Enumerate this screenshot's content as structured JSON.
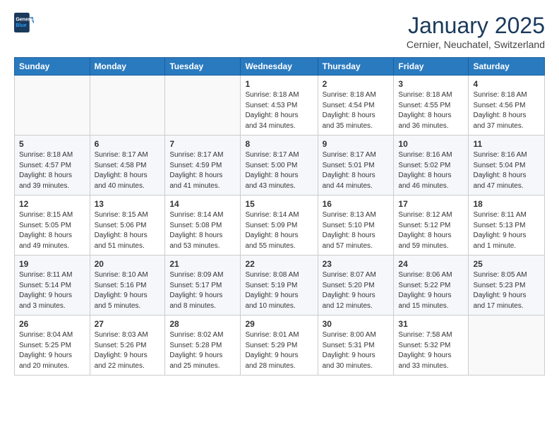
{
  "header": {
    "logo_general": "General",
    "logo_blue": "Blue",
    "month_title": "January 2025",
    "subtitle": "Cernier, Neuchatel, Switzerland"
  },
  "weekdays": [
    "Sunday",
    "Monday",
    "Tuesday",
    "Wednesday",
    "Thursday",
    "Friday",
    "Saturday"
  ],
  "weeks": [
    [
      {
        "day": "",
        "info": ""
      },
      {
        "day": "",
        "info": ""
      },
      {
        "day": "",
        "info": ""
      },
      {
        "day": "1",
        "info": "Sunrise: 8:18 AM\nSunset: 4:53 PM\nDaylight: 8 hours\nand 34 minutes."
      },
      {
        "day": "2",
        "info": "Sunrise: 8:18 AM\nSunset: 4:54 PM\nDaylight: 8 hours\nand 35 minutes."
      },
      {
        "day": "3",
        "info": "Sunrise: 8:18 AM\nSunset: 4:55 PM\nDaylight: 8 hours\nand 36 minutes."
      },
      {
        "day": "4",
        "info": "Sunrise: 8:18 AM\nSunset: 4:56 PM\nDaylight: 8 hours\nand 37 minutes."
      }
    ],
    [
      {
        "day": "5",
        "info": "Sunrise: 8:18 AM\nSunset: 4:57 PM\nDaylight: 8 hours\nand 39 minutes."
      },
      {
        "day": "6",
        "info": "Sunrise: 8:17 AM\nSunset: 4:58 PM\nDaylight: 8 hours\nand 40 minutes."
      },
      {
        "day": "7",
        "info": "Sunrise: 8:17 AM\nSunset: 4:59 PM\nDaylight: 8 hours\nand 41 minutes."
      },
      {
        "day": "8",
        "info": "Sunrise: 8:17 AM\nSunset: 5:00 PM\nDaylight: 8 hours\nand 43 minutes."
      },
      {
        "day": "9",
        "info": "Sunrise: 8:17 AM\nSunset: 5:01 PM\nDaylight: 8 hours\nand 44 minutes."
      },
      {
        "day": "10",
        "info": "Sunrise: 8:16 AM\nSunset: 5:02 PM\nDaylight: 8 hours\nand 46 minutes."
      },
      {
        "day": "11",
        "info": "Sunrise: 8:16 AM\nSunset: 5:04 PM\nDaylight: 8 hours\nand 47 minutes."
      }
    ],
    [
      {
        "day": "12",
        "info": "Sunrise: 8:15 AM\nSunset: 5:05 PM\nDaylight: 8 hours\nand 49 minutes."
      },
      {
        "day": "13",
        "info": "Sunrise: 8:15 AM\nSunset: 5:06 PM\nDaylight: 8 hours\nand 51 minutes."
      },
      {
        "day": "14",
        "info": "Sunrise: 8:14 AM\nSunset: 5:08 PM\nDaylight: 8 hours\nand 53 minutes."
      },
      {
        "day": "15",
        "info": "Sunrise: 8:14 AM\nSunset: 5:09 PM\nDaylight: 8 hours\nand 55 minutes."
      },
      {
        "day": "16",
        "info": "Sunrise: 8:13 AM\nSunset: 5:10 PM\nDaylight: 8 hours\nand 57 minutes."
      },
      {
        "day": "17",
        "info": "Sunrise: 8:12 AM\nSunset: 5:12 PM\nDaylight: 8 hours\nand 59 minutes."
      },
      {
        "day": "18",
        "info": "Sunrise: 8:11 AM\nSunset: 5:13 PM\nDaylight: 9 hours\nand 1 minute."
      }
    ],
    [
      {
        "day": "19",
        "info": "Sunrise: 8:11 AM\nSunset: 5:14 PM\nDaylight: 9 hours\nand 3 minutes."
      },
      {
        "day": "20",
        "info": "Sunrise: 8:10 AM\nSunset: 5:16 PM\nDaylight: 9 hours\nand 5 minutes."
      },
      {
        "day": "21",
        "info": "Sunrise: 8:09 AM\nSunset: 5:17 PM\nDaylight: 9 hours\nand 8 minutes."
      },
      {
        "day": "22",
        "info": "Sunrise: 8:08 AM\nSunset: 5:19 PM\nDaylight: 9 hours\nand 10 minutes."
      },
      {
        "day": "23",
        "info": "Sunrise: 8:07 AM\nSunset: 5:20 PM\nDaylight: 9 hours\nand 12 minutes."
      },
      {
        "day": "24",
        "info": "Sunrise: 8:06 AM\nSunset: 5:22 PM\nDaylight: 9 hours\nand 15 minutes."
      },
      {
        "day": "25",
        "info": "Sunrise: 8:05 AM\nSunset: 5:23 PM\nDaylight: 9 hours\nand 17 minutes."
      }
    ],
    [
      {
        "day": "26",
        "info": "Sunrise: 8:04 AM\nSunset: 5:25 PM\nDaylight: 9 hours\nand 20 minutes."
      },
      {
        "day": "27",
        "info": "Sunrise: 8:03 AM\nSunset: 5:26 PM\nDaylight: 9 hours\nand 22 minutes."
      },
      {
        "day": "28",
        "info": "Sunrise: 8:02 AM\nSunset: 5:28 PM\nDaylight: 9 hours\nand 25 minutes."
      },
      {
        "day": "29",
        "info": "Sunrise: 8:01 AM\nSunset: 5:29 PM\nDaylight: 9 hours\nand 28 minutes."
      },
      {
        "day": "30",
        "info": "Sunrise: 8:00 AM\nSunset: 5:31 PM\nDaylight: 9 hours\nand 30 minutes."
      },
      {
        "day": "31",
        "info": "Sunrise: 7:58 AM\nSunset: 5:32 PM\nDaylight: 9 hours\nand 33 minutes."
      },
      {
        "day": "",
        "info": ""
      }
    ]
  ]
}
